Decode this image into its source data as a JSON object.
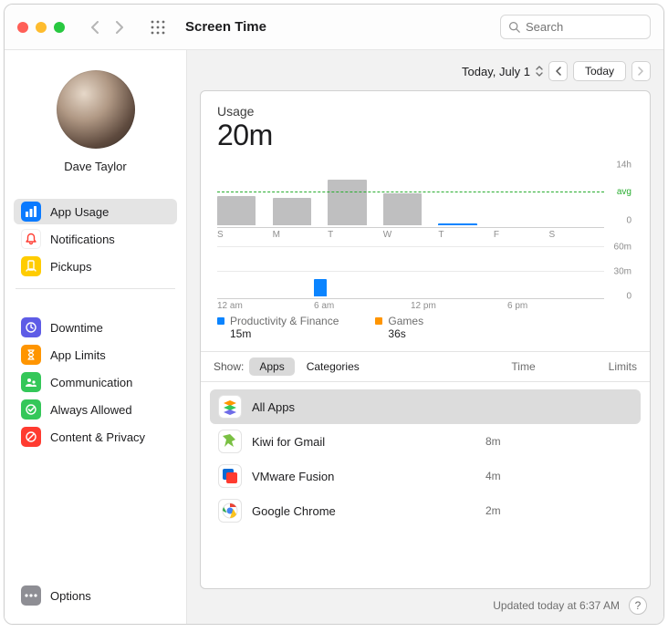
{
  "window": {
    "title": "Screen Time"
  },
  "search": {
    "placeholder": "Search"
  },
  "user": {
    "name": "Dave Taylor"
  },
  "sidebar": {
    "group1": [
      {
        "label": "App Usage",
        "icon": "chart-bar-icon",
        "color": "#0a7aff",
        "active": true
      },
      {
        "label": "Notifications",
        "icon": "bell-icon",
        "color": "#ff3b30",
        "active": false,
        "iconStyle": "outline"
      },
      {
        "label": "Pickups",
        "icon": "phone-hand-icon",
        "color": "#ffcc00",
        "active": false
      }
    ],
    "group2": [
      {
        "label": "Downtime",
        "icon": "moon-clock-icon",
        "color": "#5e5ce6"
      },
      {
        "label": "App Limits",
        "icon": "hourglass-icon",
        "color": "#ff9500"
      },
      {
        "label": "Communication",
        "icon": "comm-icon",
        "color": "#34c759"
      },
      {
        "label": "Always Allowed",
        "icon": "check-shield-icon",
        "color": "#34c759"
      },
      {
        "label": "Content & Privacy",
        "icon": "no-entry-icon",
        "color": "#ff3b30"
      }
    ],
    "options_label": "Options"
  },
  "topnav": {
    "date_label": "Today, July 1",
    "today_btn": "Today"
  },
  "usage": {
    "title": "Usage",
    "value": "20m"
  },
  "chart_data": [
    {
      "type": "bar",
      "name": "weekly-usage-hours",
      "categories": [
        "S",
        "M",
        "T",
        "W",
        "T",
        "F",
        "S"
      ],
      "values": [
        6.5,
        6,
        10,
        7,
        0.33,
        0,
        0
      ],
      "avg": 6.5,
      "ylim": [
        0,
        14
      ],
      "yticks": [
        0,
        14
      ],
      "ylabel_unit": "h",
      "avg_label": "avg",
      "bar_color": "#bfbfc0",
      "today_index": 4,
      "today_color": "#0a84ff"
    },
    {
      "type": "bar",
      "name": "hourly-usage-minutes-today",
      "x": [
        "12 am",
        "",
        "",
        "",
        "",
        "",
        "6 am",
        "",
        "",
        "",
        "",
        "",
        "12 pm",
        "",
        "",
        "",
        "",
        "",
        "6 pm",
        "",
        "",
        "",
        "",
        ""
      ],
      "values": [
        0,
        0,
        0,
        0,
        0,
        0,
        20,
        0,
        0,
        0,
        0,
        0,
        0,
        0,
        0,
        0,
        0,
        0,
        0,
        0,
        0,
        0,
        0,
        0
      ],
      "ylim": [
        0,
        60
      ],
      "yticks": [
        0,
        30,
        60
      ],
      "ylabel_unit": "m",
      "xticks_visible": [
        "12 am",
        "6 am",
        "12 pm",
        "6 pm"
      ],
      "bar_color": "#0a84ff"
    }
  ],
  "legend": [
    {
      "label": "Productivity & Finance",
      "value": "15m",
      "color": "#0a84ff"
    },
    {
      "label": "Games",
      "value": "36s",
      "color": "#ff9500"
    }
  ],
  "filter": {
    "show_label": "Show:",
    "segments": [
      "Apps",
      "Categories"
    ],
    "active_segment": 0,
    "col_time": "Time",
    "col_limits": "Limits"
  },
  "apps": [
    {
      "name": "All Apps",
      "time": "",
      "selected": true,
      "icon": "stack-icon",
      "icon_bg": "#ffffff"
    },
    {
      "name": "Kiwi for Gmail",
      "time": "8m",
      "selected": false,
      "icon": "kiwi-icon",
      "icon_bg": "#ffffff"
    },
    {
      "name": "VMware Fusion",
      "time": "4m",
      "selected": false,
      "icon": "vmware-icon",
      "icon_bg": "#ffffff"
    },
    {
      "name": "Google Chrome",
      "time": "2m",
      "selected": false,
      "icon": "chrome-icon",
      "icon_bg": "#ffffff"
    }
  ],
  "footer": {
    "updated": "Updated today at 6:37 AM"
  }
}
